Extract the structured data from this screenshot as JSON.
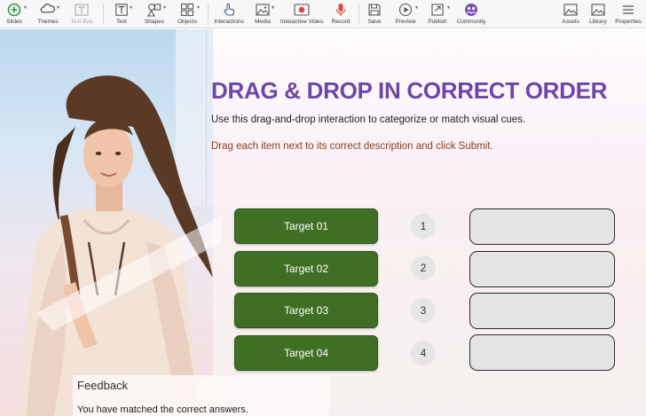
{
  "toolbar": {
    "items": [
      {
        "label": "Slides",
        "icon": "add-circle-icon"
      },
      {
        "label": "Themes",
        "icon": "themes-icon"
      },
      {
        "label": "Text Box",
        "icon": "text-box-icon"
      },
      {
        "label": "Text",
        "icon": "text-icon"
      },
      {
        "label": "Shapes",
        "icon": "shapes-icon"
      },
      {
        "label": "Objects",
        "icon": "objects-icon"
      },
      {
        "label": "Interactions",
        "icon": "hand-pointer-icon"
      },
      {
        "label": "Media",
        "icon": "media-icon"
      },
      {
        "label": "Interactive Video",
        "icon": "interactive-video-icon"
      },
      {
        "label": "Record",
        "icon": "microphone-icon"
      },
      {
        "label": "Save",
        "icon": "save-icon"
      },
      {
        "label": "Preview",
        "icon": "play-icon"
      },
      {
        "label": "Publish",
        "icon": "publish-icon"
      },
      {
        "label": "Community",
        "icon": "community-icon"
      },
      {
        "label": "Assets",
        "icon": "assets-icon"
      },
      {
        "label": "Library",
        "icon": "library-icon"
      },
      {
        "label": "Properties",
        "icon": "menu-icon"
      }
    ]
  },
  "slide": {
    "title": "DRAG & DROP IN CORRECT ORDER",
    "subtitle": "Use this drag-and-drop interaction to categorize or match visual cues.",
    "instruction": "Drag each item next to its correct description and click Submit.",
    "targets": [
      "Target 01",
      "Target 02",
      "Target 03",
      "Target 04"
    ],
    "numbers": [
      "1",
      "2",
      "3",
      "4"
    ],
    "feedback": {
      "title": "Feedback",
      "message": "You have matched the correct answers."
    }
  },
  "colors": {
    "title": "#6e46a8",
    "instruction": "#8a3b1c",
    "target": "#3f6f24",
    "accent": "#2e9a4a"
  }
}
